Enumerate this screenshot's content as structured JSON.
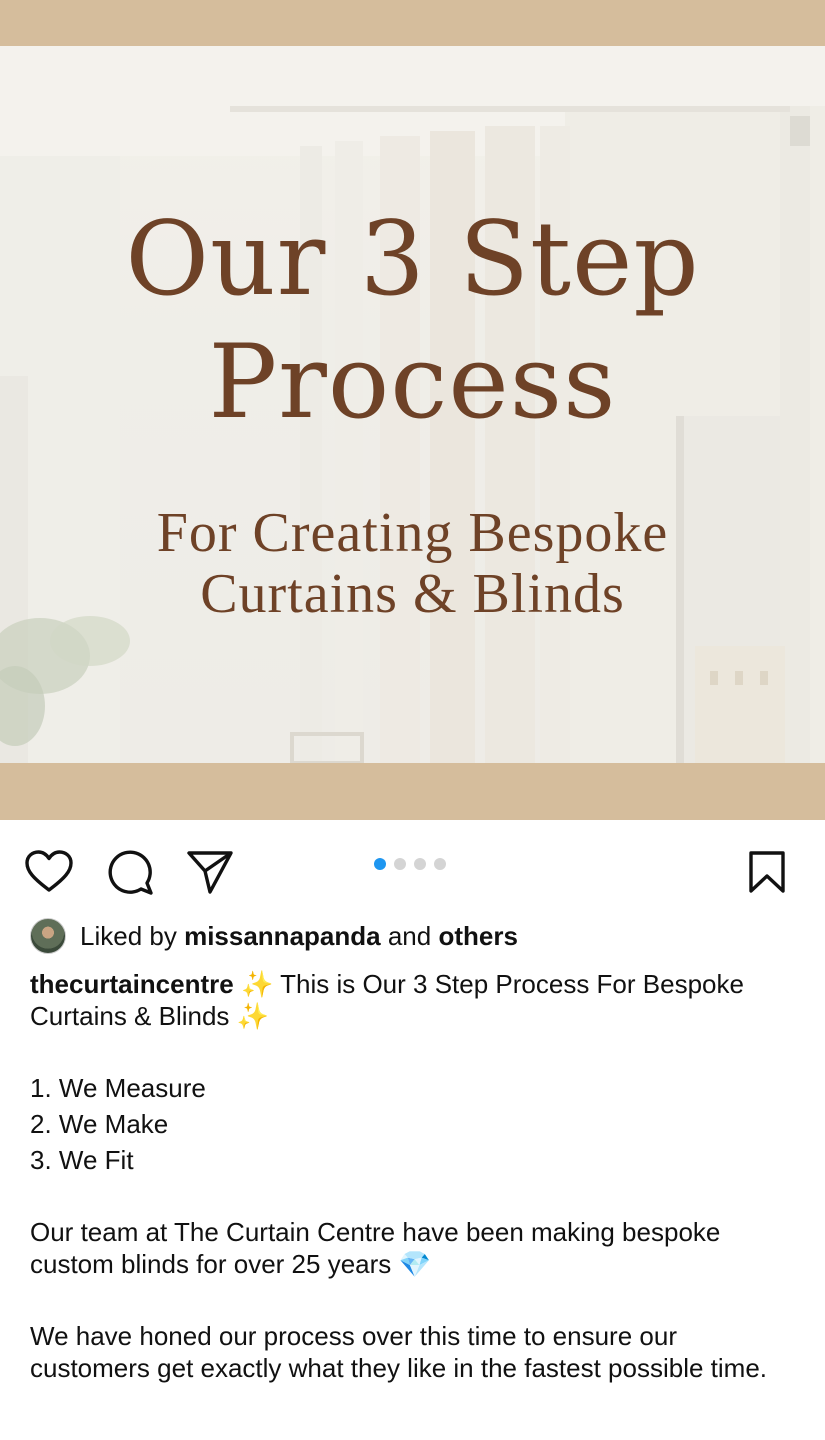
{
  "post": {
    "headline_line1": "Our 3 Step",
    "headline_line2": "Process",
    "sub_line1": "For Creating Bespoke",
    "sub_line2": "Curtains & Blinds"
  },
  "carousel": {
    "total": 4,
    "active_index": 0,
    "active_color": "#1e96f0"
  },
  "likes": {
    "prefix": "Liked by",
    "user": "missannapanda",
    "and": "and",
    "others": "others"
  },
  "caption": {
    "username": "thecurtaincentre",
    "intro_emoji": "✨",
    "intro_text": " This is Our 3 Step Process For Bespoke Curtains & Blinds ",
    "intro_emoji_end": "✨",
    "steps": [
      "1. We Measure",
      "2. We Make",
      "3. We Fit"
    ],
    "para1": "Our team at The Curtain Centre have been making bespoke custom blinds for over 25 years ",
    "para1_emoji": "💎",
    "para2": "We have honed our process over this time to ensure our customers get exactly what they like in the fastest possible time."
  },
  "icons": {
    "like": "heart-icon",
    "comment": "comment-icon",
    "share": "send-icon",
    "save": "bookmark-icon"
  },
  "colors": {
    "banner": "#d5bd9c",
    "headline": "#6e4227"
  }
}
